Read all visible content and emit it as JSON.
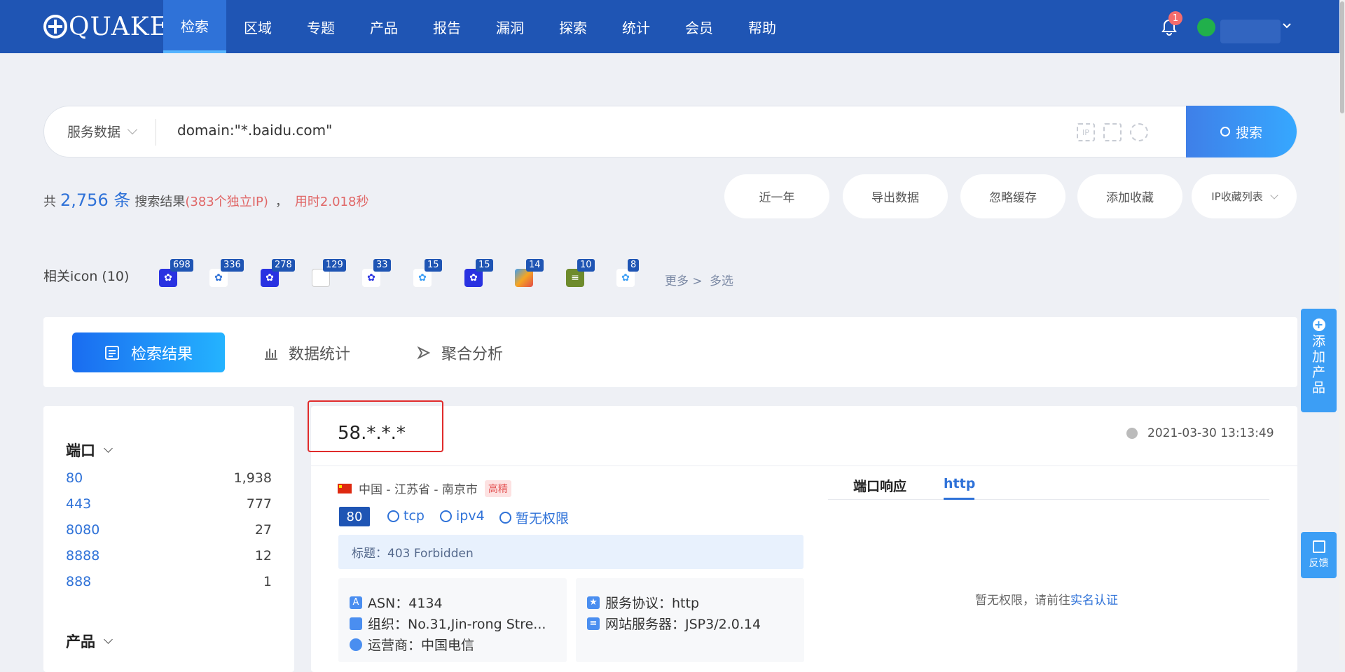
{
  "header": {
    "logo": "QUAKE",
    "nav": [
      "检索",
      "区域",
      "专题",
      "产品",
      "报告",
      "漏洞",
      "探索",
      "统计",
      "会员",
      "帮助"
    ],
    "notification_count": "1",
    "colors": {
      "bar": "#1f55b4",
      "active": "#2f72d8"
    }
  },
  "search": {
    "type_label": "服务数据",
    "query": "domain:\"*.baidu.com\"",
    "button_label": "搜索"
  },
  "summary": {
    "prefix": "共",
    "count": "2,756 条",
    "label": "搜索结果",
    "unique_ip": "(383个独立IP)",
    "comma": "，",
    "elapsed": "用时2.018秒"
  },
  "actions": [
    "近一年",
    "导出数据",
    "忽略缓存",
    "添加收藏",
    "IP收藏列表"
  ],
  "related_icons": {
    "label": "相关icon (10)",
    "items": [
      {
        "count": "698",
        "icon": "baidu-paw-icon"
      },
      {
        "count": "336",
        "icon": "baidu-du-icon"
      },
      {
        "count": "278",
        "icon": "baidu-paw-icon"
      },
      {
        "count": "129",
        "icon": "broken-image-icon"
      },
      {
        "count": "33",
        "icon": "baidu-du-icon"
      },
      {
        "count": "15",
        "icon": "baidu-du-icon"
      },
      {
        "count": "15",
        "icon": "baidu-paw-icon"
      },
      {
        "count": "14",
        "icon": "colorful-logo-icon"
      },
      {
        "count": "10",
        "icon": "stack-logo-icon"
      },
      {
        "count": "8",
        "icon": "baidu-du-icon"
      }
    ],
    "more": "更多 >",
    "multi": "多选"
  },
  "tabs": [
    "检索结果",
    "数据统计",
    "聚合分析"
  ],
  "sidebar": {
    "port_title": "端口",
    "ports": [
      {
        "k": "80",
        "v": "1,938"
      },
      {
        "k": "443",
        "v": "777"
      },
      {
        "k": "8080",
        "v": "27"
      },
      {
        "k": "8888",
        "v": "12"
      },
      {
        "k": "888",
        "v": "1"
      }
    ],
    "product_title": "产品"
  },
  "result": {
    "ip": "58.*.*.*",
    "time": "2021-03-30 13:13:49",
    "location": "中国 - 江苏省 - 南京市",
    "tag": "高精",
    "port": "80",
    "transport": "tcp",
    "ipver": "ipv4",
    "perm": "暂无权限",
    "title": "标题：403 Forbidden",
    "asn": "ASN：4134",
    "org": "组织：No.31,Jin-rong Stre...",
    "isp": "运营商：中国电信",
    "protocol": "服务协议：http",
    "server": "网站服务器：JSP3/2.0.14",
    "tab_port_resp": "端口响应",
    "tab_http": "http",
    "noperm_text": "暂无权限，请前往",
    "noperm_link": "实名认证"
  },
  "floating": {
    "add_product": [
      "添",
      "加",
      "产",
      "品"
    ],
    "feedback": "反馈"
  }
}
